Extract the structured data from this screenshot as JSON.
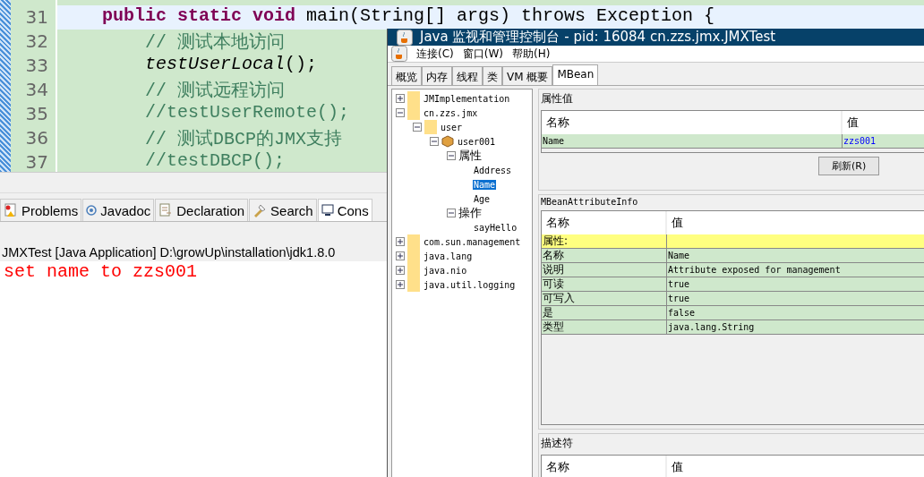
{
  "editor": {
    "lines": [
      {
        "number": "31",
        "kind": "method",
        "highlighted": true,
        "segments": [
          {
            "kind": "keyword",
            "text": "public static void"
          },
          {
            "kind": "plain",
            "text": " main(String[] args) throws Exception {"
          }
        ]
      },
      {
        "number": "32",
        "kind": "statement",
        "highlighted": false,
        "segments": [
          {
            "kind": "comment",
            "text": "// 测试本地访问"
          }
        ]
      },
      {
        "number": "33",
        "kind": "statement",
        "highlighted": false,
        "segments": [
          {
            "kind": "italic",
            "text": "testUserLocal"
          },
          {
            "kind": "plain",
            "text": "();"
          }
        ]
      },
      {
        "number": "34",
        "kind": "statement",
        "highlighted": false,
        "segments": [
          {
            "kind": "comment",
            "text": "// 测试远程访问"
          }
        ]
      },
      {
        "number": "35",
        "kind": "statement",
        "highlighted": false,
        "segments": [
          {
            "kind": "comment",
            "text": "//testUserRemote();"
          }
        ]
      },
      {
        "number": "36",
        "kind": "statement",
        "highlighted": false,
        "segments": [
          {
            "kind": "comment",
            "text": "// 测试DBCP的JMX支持"
          }
        ]
      },
      {
        "number": "37",
        "kind": "statement",
        "highlighted": false,
        "segments": [
          {
            "kind": "comment",
            "text": "//testDBCP();"
          }
        ]
      }
    ]
  },
  "bottom_tabs": [
    {
      "label": "Problems",
      "kind": "problems",
      "selected": false
    },
    {
      "label": "Javadoc",
      "kind": "javadoc",
      "selected": false
    },
    {
      "label": "Declaration",
      "kind": "declaration",
      "selected": false
    },
    {
      "label": "Search",
      "kind": "search",
      "selected": false
    },
    {
      "label": "Cons",
      "kind": "console",
      "selected": true
    }
  ],
  "console": {
    "title": "JMXTest [Java Application] D:\\growUp\\installation\\jdk1.8.0",
    "output": "set name to zzs001"
  },
  "jconsole": {
    "title": "Java 监视和管理控制台 - pid: 16084 cn.zzs.jmx.JMXTest",
    "menu": [
      "连接(C)",
      "窗口(W)",
      "帮助(H)"
    ],
    "tabs": [
      {
        "label": "概览",
        "selected": false
      },
      {
        "label": "内存",
        "selected": false
      },
      {
        "label": "线程",
        "selected": false
      },
      {
        "label": "类",
        "selected": false
      },
      {
        "label": "VM 概要",
        "selected": false
      },
      {
        "label": "MBean",
        "selected": true
      }
    ],
    "tree": [
      {
        "label": "JMImplementation",
        "kind": "folder",
        "expanded": false,
        "selected": false
      },
      {
        "label": "cn.zzs.jmx",
        "kind": "folder",
        "expanded": true,
        "selected": false,
        "children": [
          {
            "label": "user",
            "kind": "folder",
            "expanded": true,
            "selected": false,
            "children": [
              {
                "label": "user001",
                "kind": "bean",
                "expanded": true,
                "selected": false,
                "children": [
                  {
                    "label": "属性",
                    "kind": "group",
                    "expanded": true,
                    "selected": false,
                    "children": [
                      {
                        "label": "Address",
                        "kind": "leaf",
                        "selected": false
                      },
                      {
                        "label": "Name",
                        "kind": "leaf",
                        "selected": true
                      },
                      {
                        "label": "Age",
                        "kind": "leaf",
                        "selected": false
                      }
                    ]
                  },
                  {
                    "label": "操作",
                    "kind": "group",
                    "expanded": true,
                    "selected": false,
                    "children": [
                      {
                        "label": "sayHello",
                        "kind": "leaf",
                        "selected": false
                      }
                    ]
                  }
                ]
              }
            ]
          }
        ]
      },
      {
        "label": "com.sun.management",
        "kind": "folder",
        "expanded": false,
        "selected": false
      },
      {
        "label": "java.lang",
        "kind": "folder",
        "expanded": false,
        "selected": false
      },
      {
        "label": "java.nio",
        "kind": "folder",
        "expanded": false,
        "selected": false
      },
      {
        "label": "java.util.logging",
        "kind": "folder",
        "expanded": false,
        "selected": false
      }
    ],
    "attribute_values": {
      "title": "属性值",
      "columns": [
        "名称",
        "值"
      ],
      "rows": [
        {
          "name": "Name",
          "value": "zzs001"
        }
      ],
      "refresh_button": "刷新(R)"
    },
    "attribute_info": {
      "title": "MBeanAttributeInfo",
      "columns": [
        "名称",
        "值"
      ],
      "rows": [
        {
          "kind": "section",
          "name": "属性:",
          "value": ""
        },
        {
          "kind": "entry",
          "name": "名称",
          "value": "Name"
        },
        {
          "kind": "entry",
          "name": "说明",
          "value": "Attribute exposed for management"
        },
        {
          "kind": "entry",
          "name": "可读",
          "value": "true"
        },
        {
          "kind": "entry",
          "name": "可写入",
          "value": "true"
        },
        {
          "kind": "entry",
          "name": "是",
          "value": "false"
        },
        {
          "kind": "entry",
          "name": "类型",
          "value": "java.lang.String"
        }
      ]
    },
    "descriptor": {
      "title": "描述符",
      "columns": [
        "名称",
        "值"
      ]
    }
  }
}
